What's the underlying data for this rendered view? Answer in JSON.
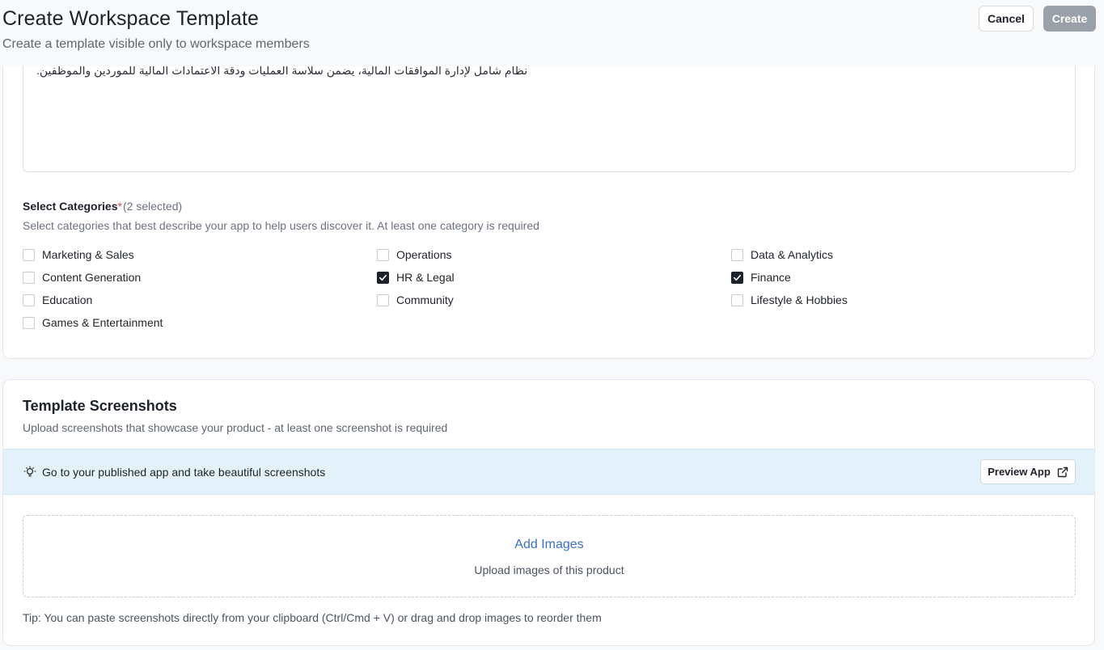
{
  "header": {
    "title": "Create Workspace Template",
    "subtitle": "Create a template visible only to workspace members",
    "cancel_label": "Cancel",
    "create_label": "Create"
  },
  "description": {
    "text": "نظام شامل لإدارة الموافقات المالية، يضمن سلاسة العمليات ودقة الاعتمادات المالية للموردين والموظفين."
  },
  "categories": {
    "label": "Select Categories",
    "required_mark": "*",
    "selected_count": "(2 selected)",
    "help": "Select categories that best describe your app to help users discover it. At least one category is required",
    "items": [
      {
        "label": "Marketing & Sales",
        "checked": false
      },
      {
        "label": "Operations",
        "checked": false
      },
      {
        "label": "Data & Analytics",
        "checked": false
      },
      {
        "label": "Content Generation",
        "checked": false
      },
      {
        "label": "HR & Legal",
        "checked": true
      },
      {
        "label": "Finance",
        "checked": true
      },
      {
        "label": "Education",
        "checked": false
      },
      {
        "label": "Community",
        "checked": false
      },
      {
        "label": "Lifestyle & Hobbies",
        "checked": false
      },
      {
        "label": "Games & Entertainment",
        "checked": false
      }
    ]
  },
  "screenshots": {
    "title": "Template Screenshots",
    "subtitle": "Upload screenshots that showcase your product - at least one screenshot is required",
    "tip_icon": "lightbulb-icon",
    "tip": "Go to your published app and take beautiful screenshots",
    "preview_label": "Preview App",
    "preview_icon": "external-link-icon",
    "add_images_label": "Add Images",
    "upload_sub": "Upload images of this product",
    "footer_tip": "Tip: You can paste screenshots directly from your clipboard (Ctrl/Cmd + V) or drag and drop images to reorder them"
  },
  "colors": {
    "accent_link": "#3a6fc4",
    "banner_bg": "#e3f1fb",
    "required": "#e5484d",
    "create_disabled": "#9aa0a8"
  }
}
